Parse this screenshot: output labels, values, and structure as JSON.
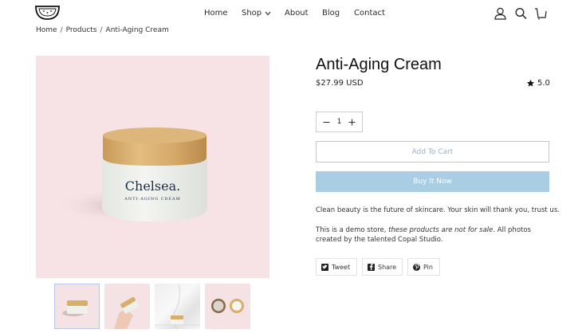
{
  "header": {
    "logo_icon": "watermelon-logo-icon",
    "nav": {
      "home": "Home",
      "shop": "Shop",
      "about": "About",
      "blog": "Blog",
      "contact": "Contact"
    },
    "icons": [
      "account-icon",
      "search-icon",
      "cart-icon"
    ]
  },
  "breadcrumb": {
    "home": "Home",
    "sep1": "/",
    "products": "Products",
    "sep2": "/",
    "current": "Anti-Aging Cream"
  },
  "product": {
    "title": "Anti-Aging Cream",
    "price": "$27.99 USD",
    "rating": "5.0",
    "quantity": "1",
    "add_to_cart": "Add To Cart",
    "buy_now": "Buy It Now",
    "jar_brand": "Chelsea.",
    "jar_label": "ANTI-AGING CREAM",
    "description_1": "Clean beauty is the future of skincare. Your skin will thank you, trust us.",
    "description_2_a": "This is a demo store, ",
    "description_2_em": "these products are not for sale",
    "description_2_b": ". All photos created by the talented Copal Studio."
  },
  "share": {
    "tweet": "Tweet",
    "facebook": "Share",
    "pinterest": "Pin"
  },
  "colors": {
    "image_bg": "#f7e3e6",
    "buy_now_bg": "#a9cde2",
    "add_to_cart_text": "#9bb0c3"
  }
}
